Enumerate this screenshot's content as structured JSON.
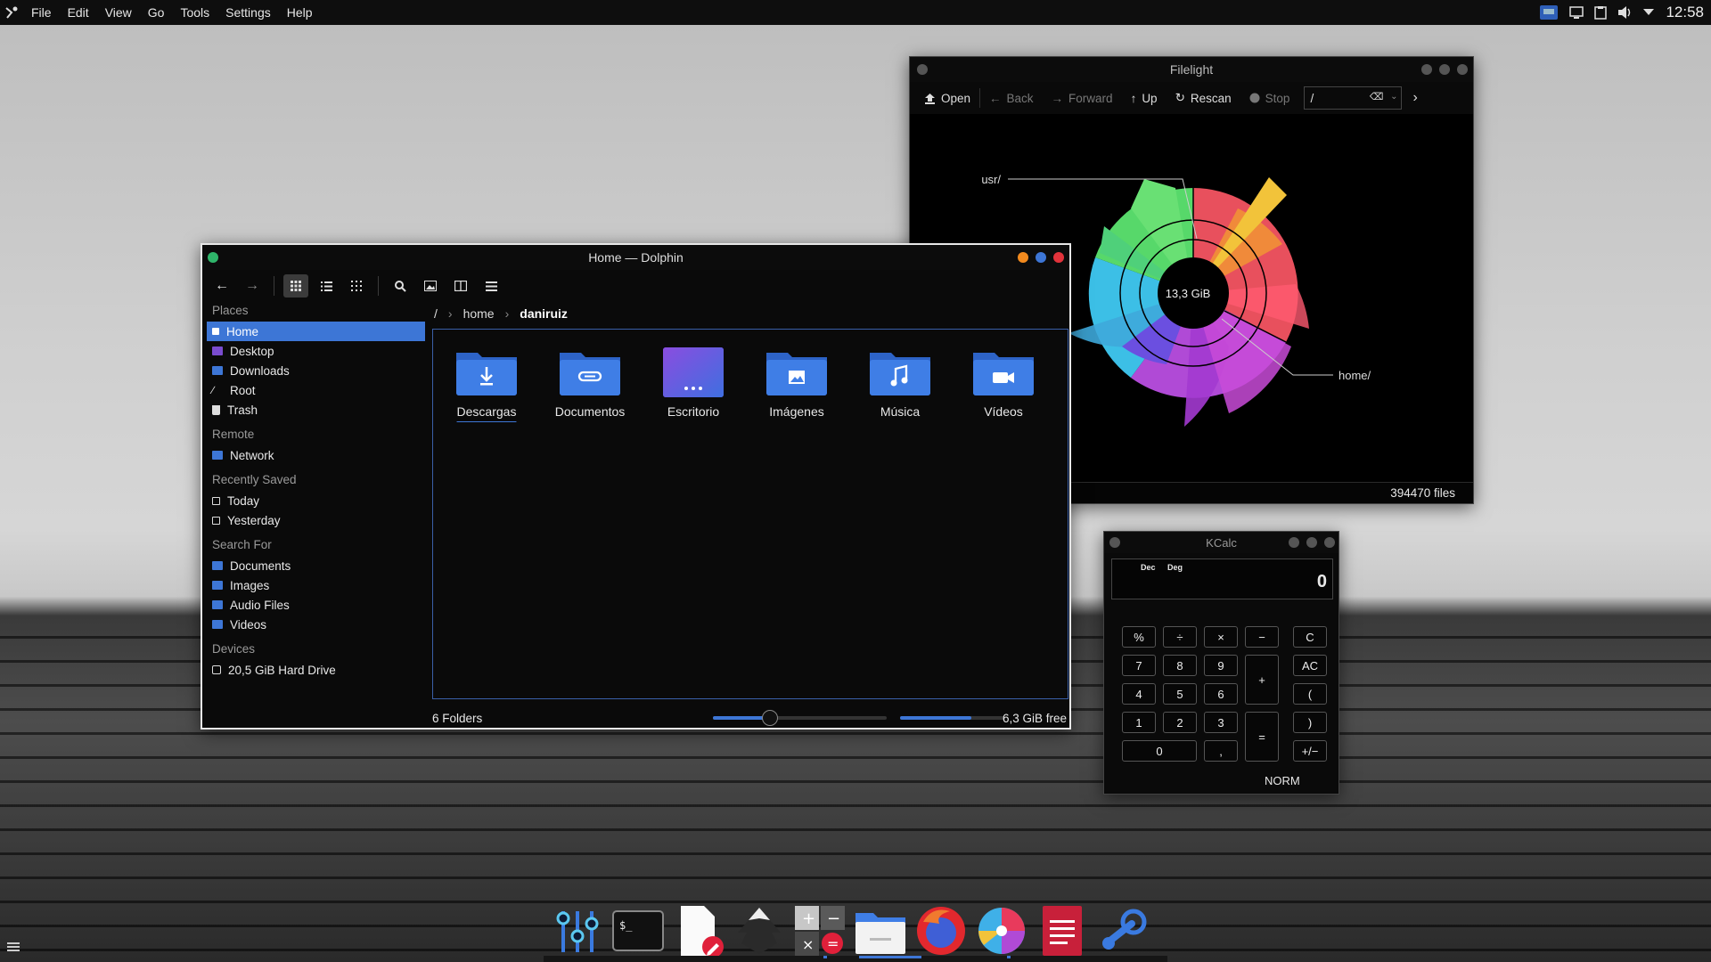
{
  "topbar": {
    "menus": [
      "File",
      "Edit",
      "View",
      "Go",
      "Tools",
      "Settings",
      "Help"
    ],
    "clock": "12:58",
    "tray_icons": [
      "network-icon",
      "display-icon",
      "clipboard-icon",
      "volume-icon",
      "chevron-down-icon"
    ]
  },
  "dolphin": {
    "title": "Home — Dolphin",
    "places": [
      {
        "header": "Places",
        "items": [
          {
            "label": "Home",
            "icon": "home-icon",
            "selected": true
          },
          {
            "label": "Desktop",
            "icon": "desktop-icon"
          },
          {
            "label": "Downloads",
            "icon": "downloads-icon"
          },
          {
            "label": "Root",
            "icon": "root-icon"
          },
          {
            "label": "Trash",
            "icon": "trash-icon"
          }
        ]
      },
      {
        "header": "Remote",
        "items": [
          {
            "label": "Network",
            "icon": "network-folder-icon"
          }
        ]
      },
      {
        "header": "Recently Saved",
        "items": [
          {
            "label": "Today",
            "icon": "calendar-icon"
          },
          {
            "label": "Yesterday",
            "icon": "calendar-icon"
          }
        ]
      },
      {
        "header": "Search For",
        "items": [
          {
            "label": "Documents",
            "icon": "documents-icon"
          },
          {
            "label": "Images",
            "icon": "images-icon"
          },
          {
            "label": "Audio Files",
            "icon": "audio-icon"
          },
          {
            "label": "Videos",
            "icon": "videos-icon"
          }
        ]
      },
      {
        "header": "Devices",
        "items": [
          {
            "label": "20,5 GiB Hard Drive",
            "icon": "hard-drive-icon"
          }
        ]
      }
    ],
    "breadcrumb": [
      "/",
      "home",
      "daniruiz"
    ],
    "folders": [
      {
        "label": "Descargas",
        "icon": "download-folder-icon"
      },
      {
        "label": "Documentos",
        "icon": "documents-folder-icon"
      },
      {
        "label": "Escritorio",
        "icon": "desktop-folder-icon"
      },
      {
        "label": "Imágenes",
        "icon": "pictures-folder-icon"
      },
      {
        "label": "Música",
        "icon": "music-folder-icon"
      },
      {
        "label": "Vídeos",
        "icon": "videos-folder-icon"
      }
    ],
    "status": {
      "count": "6 Folders",
      "free": "6,3 GiB free",
      "zoom_fraction": 0.33,
      "disk_used_fraction": 0.68
    },
    "accent": "#3d76d6"
  },
  "filelight": {
    "title": "Filelight",
    "toolbar": {
      "open": "Open",
      "back": "Back",
      "forward": "Forward",
      "up": "Up",
      "rescan": "Rescan",
      "stop": "Stop"
    },
    "path": "/",
    "center_label": "13,3 GiB",
    "labels": {
      "usr": "usr/",
      "home": "home/"
    },
    "files": "394470 files"
  },
  "kcalc": {
    "title": "KCalc",
    "mode_dec": "Dec",
    "mode_deg": "Deg",
    "display": "0",
    "norm": "NORM",
    "buttons": {
      "percent": "%",
      "divide": "÷",
      "multiply": "×",
      "minus": "−",
      "clear": "C",
      "seven": "7",
      "eight": "8",
      "nine": "9",
      "plus": "+",
      "all_clear": "AC",
      "four": "4",
      "five": "5",
      "six": "6",
      "open_paren": "(",
      "one": "1",
      "two": "2",
      "three": "3",
      "equals": "=",
      "close_paren": ")",
      "zero": "0",
      "comma": ",",
      "sign": "+/−"
    }
  },
  "dock": {
    "apps": [
      "mixer-icon",
      "terminal-icon",
      "text-editor-icon",
      "inkscape-icon",
      "calculator-icon",
      "file-manager-icon",
      "firefox-icon",
      "filelight-icon",
      "document-viewer-icon",
      "steam-icon"
    ]
  }
}
